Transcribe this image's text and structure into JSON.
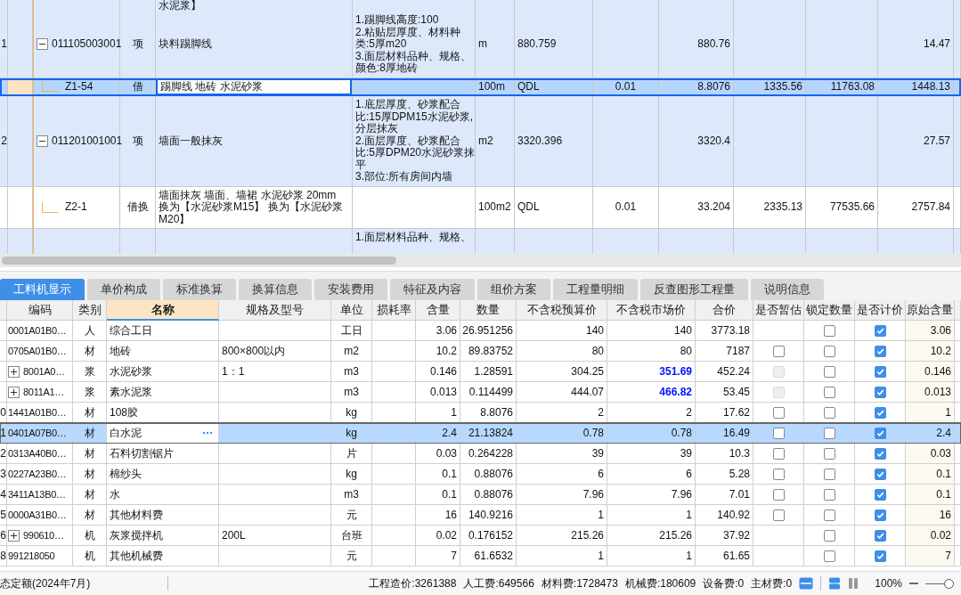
{
  "upper_grid": {
    "rows": [
      {
        "kind": "item",
        "selected": false,
        "name_lines": [
          "水泥浆】"
        ]
      },
      {
        "kind": "item",
        "selected": false,
        "expanded": true,
        "row_number": "1",
        "code": "011105003001",
        "type": "项",
        "name_lines": [
          "块料踢脚线"
        ],
        "feature_lines": [
          "1.踢脚线高度:100",
          "2.粘贴层厚度、材料种",
          "类:5厚m20",
          "3.面层材料品种、规格、",
          "颜色:8厚地砖"
        ],
        "unit": "m",
        "expression": "880.759",
        "quantity": "880.76",
        "column_12": "14.47"
      },
      {
        "kind": "sub",
        "selected": true,
        "code": "Z1-54",
        "type": "借",
        "name_lines": [
          "踢脚线 地砖 水泥砂浆"
        ],
        "unit": "100m",
        "expression": "QDL",
        "content": "0.01",
        "quantity": "8.8076",
        "column_10": "1335.56",
        "column_11": "11763.08",
        "column_12": "1448.13"
      },
      {
        "kind": "item",
        "selected": false,
        "expanded": true,
        "row_number": "2",
        "code": "011201001001",
        "type": "项",
        "name_lines": [
          "墙面一般抹灰"
        ],
        "feature_lines": [
          "1.底层厚度、砂浆配合",
          "比:15厚DPM15水泥砂浆,",
          "分层抹灰",
          "2.面层厚度、砂浆配合",
          "比:5厚DPM20水泥砂浆抹",
          "平",
          "3.部位:所有房间内墙"
        ],
        "unit": "m2",
        "expression": "3320.396",
        "quantity": "3320.4",
        "column_12": "27.57"
      },
      {
        "kind": "sub",
        "selected": false,
        "code": "Z2-1",
        "type": "借换",
        "name_lines": [
          "墙面抹灰 墙面、墙裙 水泥砂浆 20mm",
          "换为【水泥砂浆M15】  换为【水泥砂浆",
          "M20】"
        ],
        "unit": "100m2",
        "expression": "QDL",
        "content": "0.01",
        "quantity": "33.204",
        "column_10": "2335.13",
        "column_11": "77535.66",
        "column_12": "2757.84"
      },
      {
        "kind": "item",
        "selected": false,
        "feature_lines": [
          "1.面层材料品种、规格、"
        ]
      }
    ]
  },
  "tabs": [
    {
      "label": "工料机显示",
      "selected": true
    },
    {
      "label": "单价构成",
      "selected": false
    },
    {
      "label": "标准换算",
      "selected": false
    },
    {
      "label": "换算信息",
      "selected": false
    },
    {
      "label": "安装费用",
      "selected": false
    },
    {
      "label": "特征及内容",
      "selected": false
    },
    {
      "label": "组价方案",
      "selected": false
    },
    {
      "label": "工程量明细",
      "selected": false
    },
    {
      "label": "反查图形工程量",
      "selected": false
    },
    {
      "label": "说明信息",
      "selected": false
    }
  ],
  "lower_grid": {
    "columns": [
      "编码",
      "类别",
      "名称",
      "规格及型号",
      "单位",
      "损耗率",
      "含量",
      "数量",
      "不含税预算价",
      "不含税市场价",
      "合价",
      "是否暂估",
      "锁定数量",
      "是否计价",
      "原始含量"
    ],
    "rows": [
      {
        "code": "0001A01B0…",
        "type": "人",
        "name": "综合工日",
        "spec": "",
        "unit": "工日",
        "content": "3.06",
        "quantity": "26.951256",
        "budget_price": "140",
        "market_price": "140",
        "market_changed": false,
        "total": "3773.18",
        "locked": false,
        "priced": true,
        "original_content": "3.06",
        "selected": false
      },
      {
        "code": "0705A01B0…",
        "type": "材",
        "name": "地砖",
        "spec": "800×800以内",
        "unit": "m2",
        "content": "10.2",
        "quantity": "89.83752",
        "budget_price": "80",
        "market_price": "80",
        "market_changed": false,
        "total": "7187",
        "estimate": {
          "checked": false
        },
        "locked": false,
        "priced": true,
        "original_content": "10.2",
        "selected": false
      },
      {
        "row_number": "",
        "expandable": true,
        "code": "8001A0…",
        "type": "浆",
        "name": "水泥砂浆",
        "spec": "1：1",
        "unit": "m3",
        "content": "0.146",
        "quantity": "1.28591",
        "budget_price": "304.25",
        "market_price": "351.69",
        "market_changed": true,
        "total": "452.24",
        "estimate": {
          "checked": false,
          "disabled": true
        },
        "locked": false,
        "priced": true,
        "original_content": "0.146",
        "selected": false
      },
      {
        "expandable": true,
        "code": "8011A1…",
        "type": "浆",
        "name": "素水泥浆",
        "spec": "",
        "unit": "m3",
        "content": "0.013",
        "quantity": "0.114499",
        "budget_price": "444.07",
        "market_price": "466.82",
        "market_changed": true,
        "total": "53.45",
        "estimate": {
          "checked": false,
          "disabled": true
        },
        "locked": false,
        "priced": true,
        "original_content": "0.013",
        "selected": false
      },
      {
        "row_number": "0",
        "code": "1441A01B0…",
        "type": "材",
        "name": "108胶",
        "spec": "",
        "unit": "kg",
        "content": "1",
        "quantity": "8.8076",
        "budget_price": "2",
        "market_price": "2",
        "market_changed": false,
        "total": "17.62",
        "estimate": {
          "checked": false
        },
        "locked": false,
        "priced": true,
        "original_content": "1",
        "selected": false
      },
      {
        "row_number": "1",
        "code": "0401A07B0…",
        "type": "材",
        "name": "白水泥",
        "spec": "",
        "unit": "kg",
        "content": "2.4",
        "quantity": "21.13824",
        "budget_price": "0.78",
        "market_price": "0.78",
        "market_changed": false,
        "total": "16.49",
        "estimate": {
          "checked": false
        },
        "locked": false,
        "priced": true,
        "original_content": "2.4",
        "selected": true
      },
      {
        "row_number": "2",
        "code": "0313A40B0…",
        "type": "材",
        "name": "石料切割锯片",
        "spec": "",
        "unit": "片",
        "content": "0.03",
        "quantity": "0.264228",
        "budget_price": "39",
        "market_price": "39",
        "market_changed": false,
        "total": "10.3",
        "estimate": {
          "checked": false
        },
        "locked": false,
        "priced": true,
        "original_content": "0.03",
        "selected": false
      },
      {
        "row_number": "3",
        "code": "0227A23B0…",
        "type": "材",
        "name": "棉纱头",
        "spec": "",
        "unit": "kg",
        "content": "0.1",
        "quantity": "0.88076",
        "budget_price": "6",
        "market_price": "6",
        "market_changed": false,
        "total": "5.28",
        "estimate": {
          "checked": false
        },
        "locked": false,
        "priced": true,
        "original_content": "0.1",
        "selected": false
      },
      {
        "row_number": "4",
        "code": "3411A13B0…",
        "type": "材",
        "name": "水",
        "spec": "",
        "unit": "m3",
        "content": "0.1",
        "quantity": "0.88076",
        "budget_price": "7.96",
        "market_price": "7.96",
        "market_changed": false,
        "total": "7.01",
        "estimate": {
          "checked": false
        },
        "locked": false,
        "priced": true,
        "original_content": "0.1",
        "selected": false
      },
      {
        "row_number": "5",
        "code": "0000A31B0…",
        "type": "材",
        "name": "其他材料费",
        "spec": "",
        "unit": "元",
        "content": "16",
        "quantity": "140.9216",
        "budget_price": "1",
        "market_price": "1",
        "market_changed": false,
        "total": "140.92",
        "estimate": {
          "checked": false
        },
        "locked": false,
        "priced": true,
        "original_content": "16",
        "selected": false
      },
      {
        "row_number": "6",
        "expandable": true,
        "code": "990610…",
        "type": "机",
        "name": "灰浆搅拌机",
        "spec": "200L",
        "unit": "台班",
        "content": "0.02",
        "quantity": "0.176152",
        "budget_price": "215.26",
        "market_price": "215.26",
        "market_changed": false,
        "total": "37.92",
        "locked": false,
        "priced": true,
        "original_content": "0.02",
        "selected": false
      },
      {
        "row_number": "8",
        "code": "991218050",
        "type": "机",
        "name": "其他机械费",
        "spec": "",
        "unit": "元",
        "content": "7",
        "quantity": "61.6532",
        "budget_price": "1",
        "market_price": "1",
        "market_changed": false,
        "total": "61.65",
        "locked": false,
        "priced": true,
        "original_content": "7",
        "selected": false
      }
    ]
  },
  "status_bar": {
    "quota": "态定额(2024年7月)",
    "totals": [
      "工程造价:3261388",
      "人工费:649566",
      "材料费:1728473",
      "机械费:180609",
      "设备费:0",
      "主材费:0"
    ],
    "zoom": "100%",
    "zoom_slider": {
      "level": 1
    }
  }
}
